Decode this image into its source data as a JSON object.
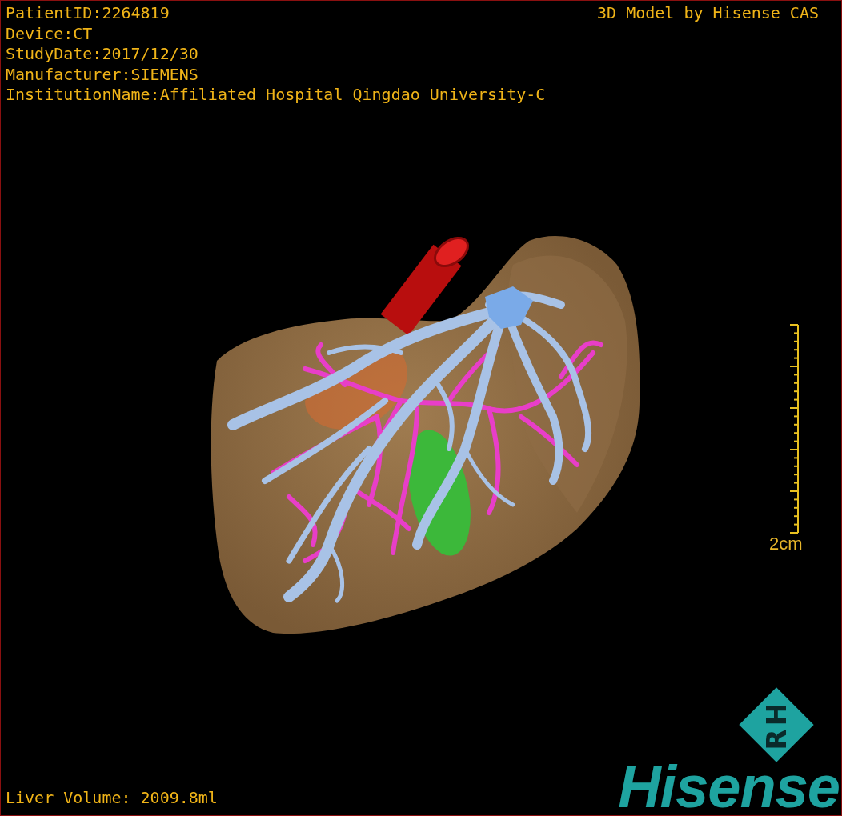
{
  "study_info": [
    "PatientID:2264819",
    "Device:CT",
    "StudyDate:2017/12/30",
    "Manufacturer:SIEMENS",
    "InstitutionName:Affiliated Hospital Qingdao University-C"
  ],
  "title": "3D Model by Hisense CAS",
  "scale_bar": {
    "label": "2cm"
  },
  "liver_volume": "Liver Volume: 2009.8ml",
  "logo": {
    "mark": "RH",
    "wordmark": "Hisense"
  }
}
